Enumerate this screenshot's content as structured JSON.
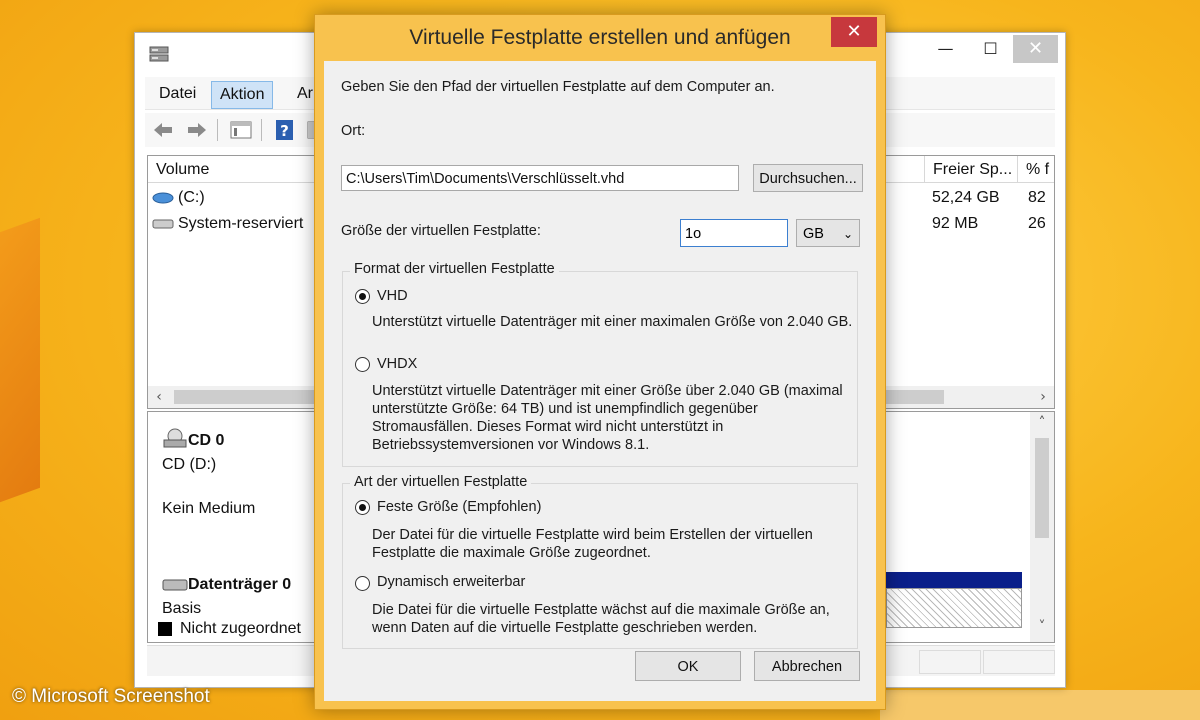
{
  "mainwin": {
    "menu": [
      "Datei",
      "Aktion",
      "Ar"
    ],
    "columns": [
      "Volume",
      "Freier Sp...",
      "% f"
    ],
    "volumes": [
      {
        "name": "(C:)",
        "free": "52,24 GB",
        "pct": "82"
      },
      {
        "name": "System-reserviert",
        "free": "92 MB",
        "pct": "26"
      }
    ],
    "disks": {
      "cd_title": "CD 0",
      "cd_drive": "CD (D:)",
      "cd_media": "Kein Medium",
      "disk0_title": "Datenträger 0",
      "disk0_type": "Basis",
      "legend_unassigned": "Nicht zugeordnet"
    }
  },
  "dialog": {
    "title": "Virtuelle Festplatte erstellen und anfügen",
    "instruction": "Geben Sie den Pfad der virtuellen Festplatte auf dem Computer an.",
    "location_label": "Ort:",
    "path_value": "C:\\Users\\Tim\\Documents\\Verschlüsselt.vhd",
    "browse_label": "Durchsuchen...",
    "size_label": "Größe der virtuellen Festplatte:",
    "size_value": "1o",
    "size_unit": "GB",
    "format_group": "Format der virtuellen Festplatte",
    "vhd_label": "VHD",
    "vhd_desc": "Unterstützt virtuelle Datenträger mit einer maximalen Größe von 2.040 GB.",
    "vhdx_label": "VHDX",
    "vhdx_desc": "Unterstützt virtuelle Datenträger mit einer Größe über 2.040 GB (maximal unterstützte Größe: 64 TB) und ist unempfindlich gegenüber Stromausfällen. Dieses Format wird nicht unterstützt in Betriebssystemversionen vor Windows 8.1.",
    "type_group": "Art der virtuellen Festplatte",
    "fixed_label": "Feste Größe (Empfohlen)",
    "fixed_desc": "Der Datei für die virtuelle Festplatte wird beim Erstellen der virtuellen Festplatte die maximale Größe zugeordnet.",
    "dynamic_label": "Dynamisch erweiterbar",
    "dynamic_desc": "Die Datei für die virtuelle Festplatte wächst auf die maximale Größe an, wenn Daten auf die virtuelle Festplatte geschrieben werden.",
    "ok_label": "OK",
    "cancel_label": "Abbrechen"
  },
  "watermark": "© Microsoft Screenshot"
}
